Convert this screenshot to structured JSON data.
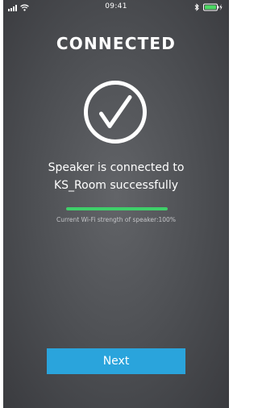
{
  "status_bar": {
    "time": "09:41",
    "signal_icon": "cellular-signal-icon",
    "wifi_icon": "wifi-icon",
    "bluetooth_icon": "bluetooth-icon",
    "battery_icon": "battery-charging-icon",
    "battery_color": "#4cd964"
  },
  "main": {
    "title": "CONNECTED",
    "status_icon": "checkmark-circle-icon",
    "message_line1": "Speaker is connected to",
    "message_line2": "KS_Room successfully",
    "wifi_strength_label": "Current Wi-Fi strength of speaker:100%",
    "wifi_strength_fraction": 1.0,
    "progress_color": "#3fd06a"
  },
  "footer": {
    "next_label": "Next",
    "button_color": "#2aa4dc"
  },
  "colors": {
    "background": "#4c4e52"
  }
}
